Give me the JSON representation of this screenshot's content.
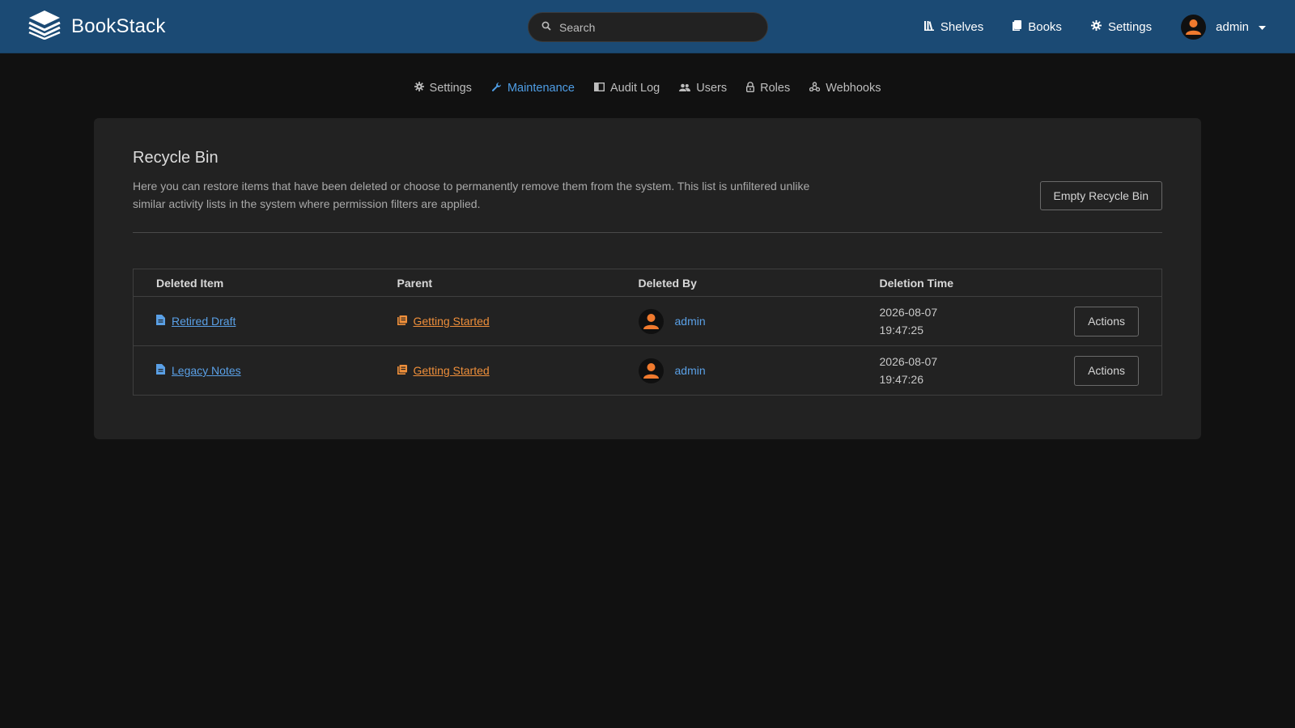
{
  "header": {
    "app_name": "BookStack",
    "search_placeholder": "Search",
    "nav": [
      {
        "label": "Shelves",
        "icon": "shelves-icon"
      },
      {
        "label": "Books",
        "icon": "book-icon"
      },
      {
        "label": "Settings",
        "icon": "gear-icon"
      }
    ],
    "user_name": "admin"
  },
  "subnav": [
    {
      "label": "Settings",
      "icon": "gear-icon",
      "active": false
    },
    {
      "label": "Maintenance",
      "icon": "wrench-icon",
      "active": true
    },
    {
      "label": "Audit Log",
      "icon": "audit-log-icon",
      "active": false
    },
    {
      "label": "Users",
      "icon": "users-icon",
      "active": false
    },
    {
      "label": "Roles",
      "icon": "lock-icon",
      "active": false
    },
    {
      "label": "Webhooks",
      "icon": "webhooks-icon",
      "active": false
    }
  ],
  "recycle_bin": {
    "title": "Recycle Bin",
    "description": "Here you can restore items that have been deleted or choose to permanently remove them from the system. This list is unfiltered unlike similar activity lists in the system where permission filters are applied.",
    "empty_button": "Empty Recycle Bin",
    "columns": [
      "Deleted Item",
      "Parent",
      "Deleted By",
      "Deletion Time"
    ],
    "rows": [
      {
        "item": "Retired Draft",
        "parent": "Getting Started",
        "deleted_by": "admin",
        "date": "2026-08-07",
        "time": "19:47:25",
        "action": "Actions"
      },
      {
        "item": "Legacy Notes",
        "parent": "Getting Started",
        "deleted_by": "admin",
        "date": "2026-08-07",
        "time": "19:47:26",
        "action": "Actions"
      }
    ]
  },
  "colors": {
    "header_bg": "#1b4a74",
    "link_blue": "#5aa0e6",
    "book_orange": "#ef8f3a",
    "active_tab": "#4f9ee6"
  }
}
